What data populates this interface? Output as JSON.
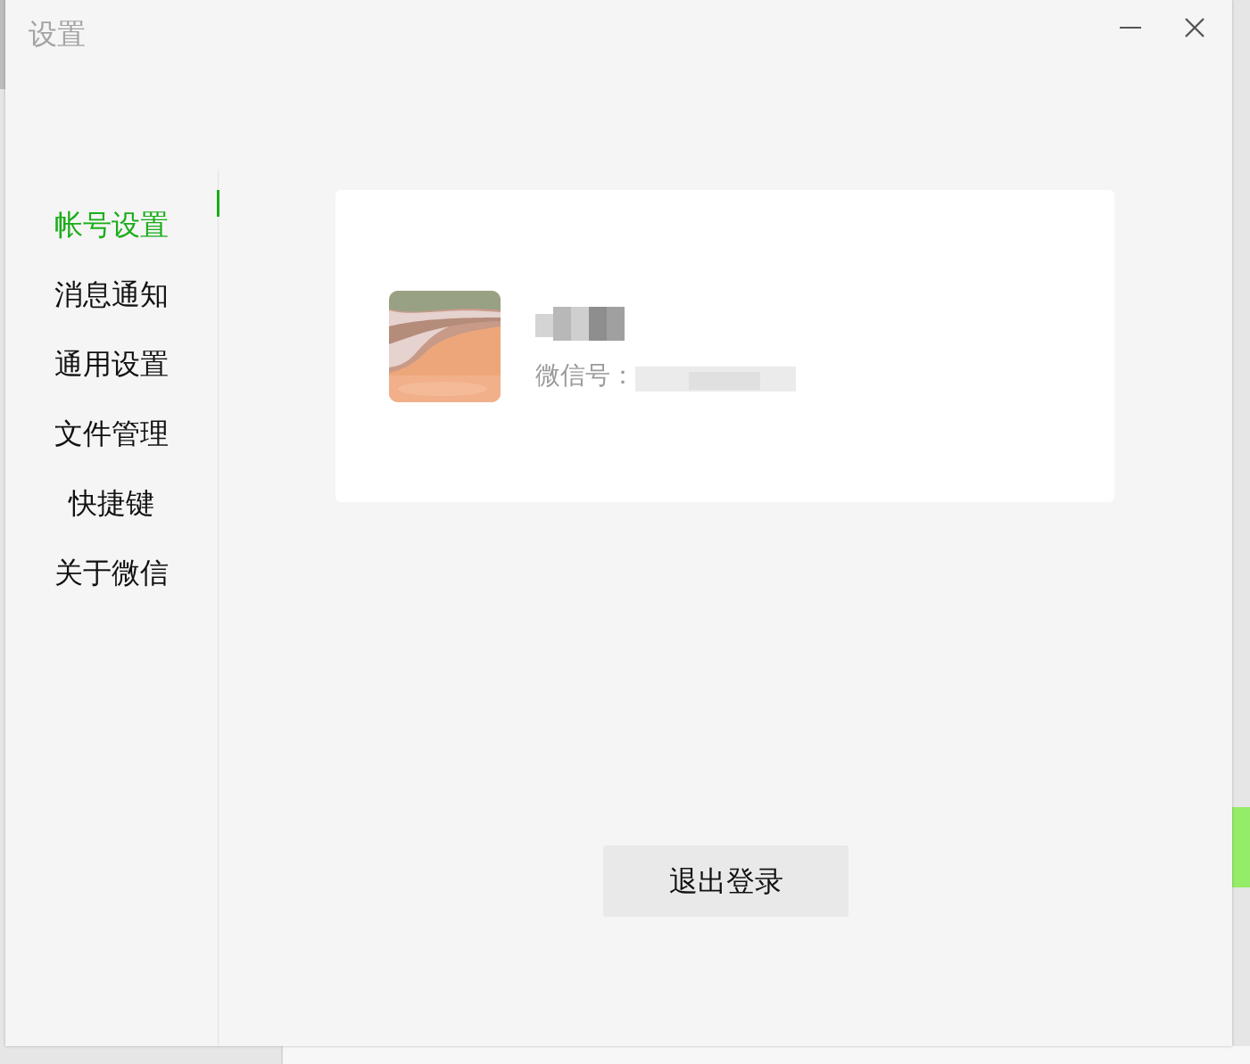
{
  "window": {
    "title": "设置"
  },
  "sidebar": {
    "items": [
      {
        "label": "帐号设置",
        "selected": true
      },
      {
        "label": "消息通知",
        "selected": false
      },
      {
        "label": "通用设置",
        "selected": false
      },
      {
        "label": "文件管理",
        "selected": false
      },
      {
        "label": "快捷键",
        "selected": false
      },
      {
        "label": "关于微信",
        "selected": false
      }
    ]
  },
  "account": {
    "id_label": "微信号："
  },
  "logout_button": {
    "label": "退出登录"
  }
}
